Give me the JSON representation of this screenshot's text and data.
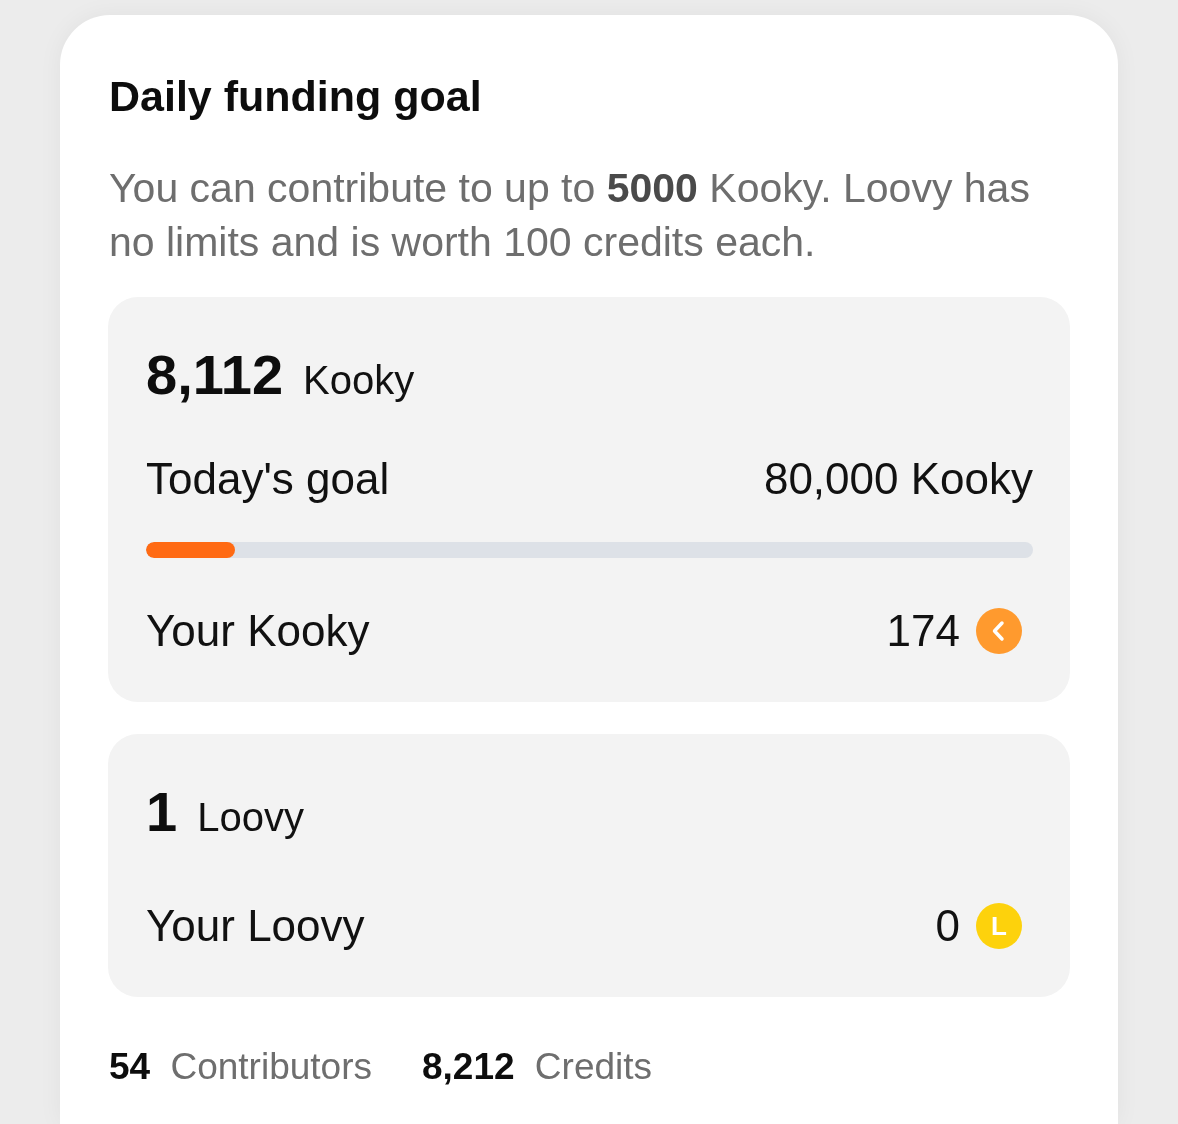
{
  "title": "Daily funding goal",
  "description": "You can contribute to up to **5000** Kooky. Loovy has no limits and is worth 100 credits each.",
  "panels": [
    {
      "amount": "8,112",
      "unit": "Kooky",
      "goal": {
        "label": "Today's goal",
        "value": "80,000 Kooky",
        "level": 0.1
      },
      "balance": {
        "label": "Your Kooky",
        "value": "174",
        "coin": {
          "kind": "chevron"
        }
      }
    },
    {
      "amount": "1",
      "unit": "Loovy",
      "balance": {
        "label": "Your Loovy",
        "value": "0",
        "coin": {
          "kind": "letter",
          "letter": "L"
        }
      }
    }
  ],
  "stats": [
    "**54** Contributors",
    "**8,212** Credits"
  ]
}
